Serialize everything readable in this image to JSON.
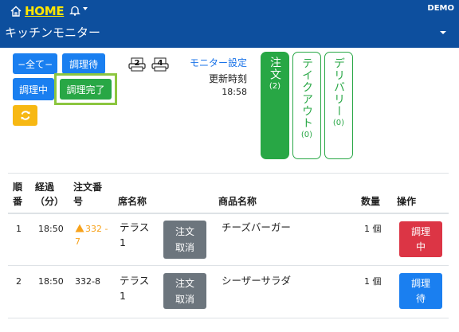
{
  "navbar": {
    "home_label": "HOME",
    "user": "DEMO",
    "title": "キッチンモニター"
  },
  "filters": {
    "all": "−全て−",
    "waiting": "調理待",
    "cooking": "調理中",
    "done": "調理完了"
  },
  "printers": [
    "2",
    "4"
  ],
  "monitor": {
    "settings_link": "モニター設定",
    "updated_label": "更新時刻",
    "updated_time": "18:58"
  },
  "tabs": [
    {
      "label": "注文",
      "count": "(2)"
    },
    {
      "label": "テイクアウト",
      "count": "(0)"
    },
    {
      "label": "デリバリー",
      "count": "(0)"
    }
  ],
  "table": {
    "headers": {
      "order": [
        "順",
        "番"
      ],
      "elapsed": [
        "経過",
        "（分）"
      ],
      "order_no": [
        "注文番",
        "号"
      ],
      "seat": "席名称",
      "product": "商品名称",
      "qty": "数量",
      "action": "操作"
    },
    "rows": [
      {
        "num": "1",
        "time": "18:50",
        "order_no": [
          "332 -",
          "7"
        ],
        "seat": [
          "テラス",
          "1"
        ],
        "cancel": [
          "注文",
          "取消"
        ],
        "product": "チーズバーガー",
        "qty": "1 個",
        "action": [
          "調理",
          "中"
        ]
      },
      {
        "num": "2",
        "time": "18:50",
        "order_no": [
          "332-8"
        ],
        "seat": [
          "テラス",
          "1"
        ],
        "cancel": [
          "注文",
          "取消"
        ],
        "product": "シーザーサラダ",
        "qty": "1 個",
        "action": [
          "調理",
          "待"
        ]
      }
    ]
  },
  "colors": {
    "navbar": "#0d4f9e",
    "primary": "#1a7ff0",
    "success": "#28a745",
    "warning": "#f7b813",
    "danger": "#dc3545",
    "secondary": "#6c757d",
    "home_link": "#ffe600",
    "highlight": "#8cc63f"
  }
}
